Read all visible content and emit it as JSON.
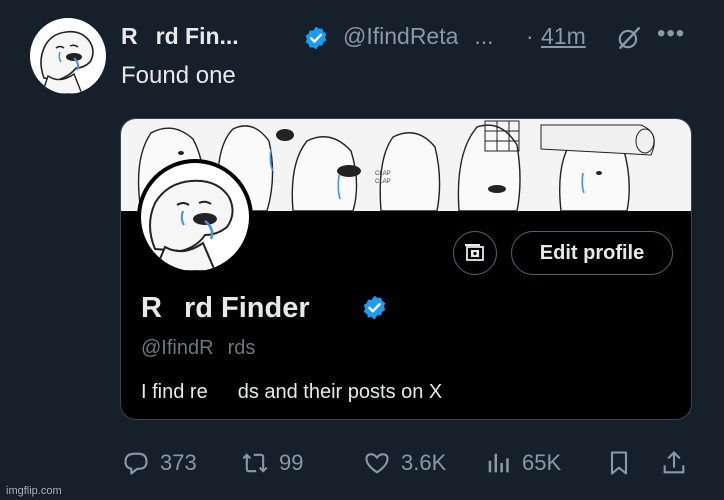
{
  "tweet": {
    "author_name_start": "R",
    "author_name_end": "rd Fin...",
    "handle_start": "@IfindReta",
    "handle_end": "...",
    "separator": "·",
    "time": "41m",
    "text": "Found one"
  },
  "card": {
    "edit_profile_label": "Edit profile",
    "profile_name_start": "R",
    "profile_name_end": "rd Finder",
    "profile_handle_start": "@IfindR",
    "profile_handle_end": "rds",
    "bio_start": "I find re",
    "bio_end": "ds and their posts on X",
    "banner_text": [
      "CLAP",
      "CLAP"
    ]
  },
  "actions": {
    "replies": "373",
    "reposts": "99",
    "likes": "3.6K",
    "views": "65K"
  },
  "watermark": "imgflip.com",
  "colors": {
    "background": "#15202b",
    "verified": "#1d9bf0",
    "muted": "#8b98a5"
  },
  "icons": [
    "reply-icon",
    "repost-icon",
    "like-icon",
    "views-icon",
    "bookmark-icon",
    "share-icon",
    "grok-icon",
    "more-icon",
    "verified-icon",
    "camera-icon"
  ]
}
